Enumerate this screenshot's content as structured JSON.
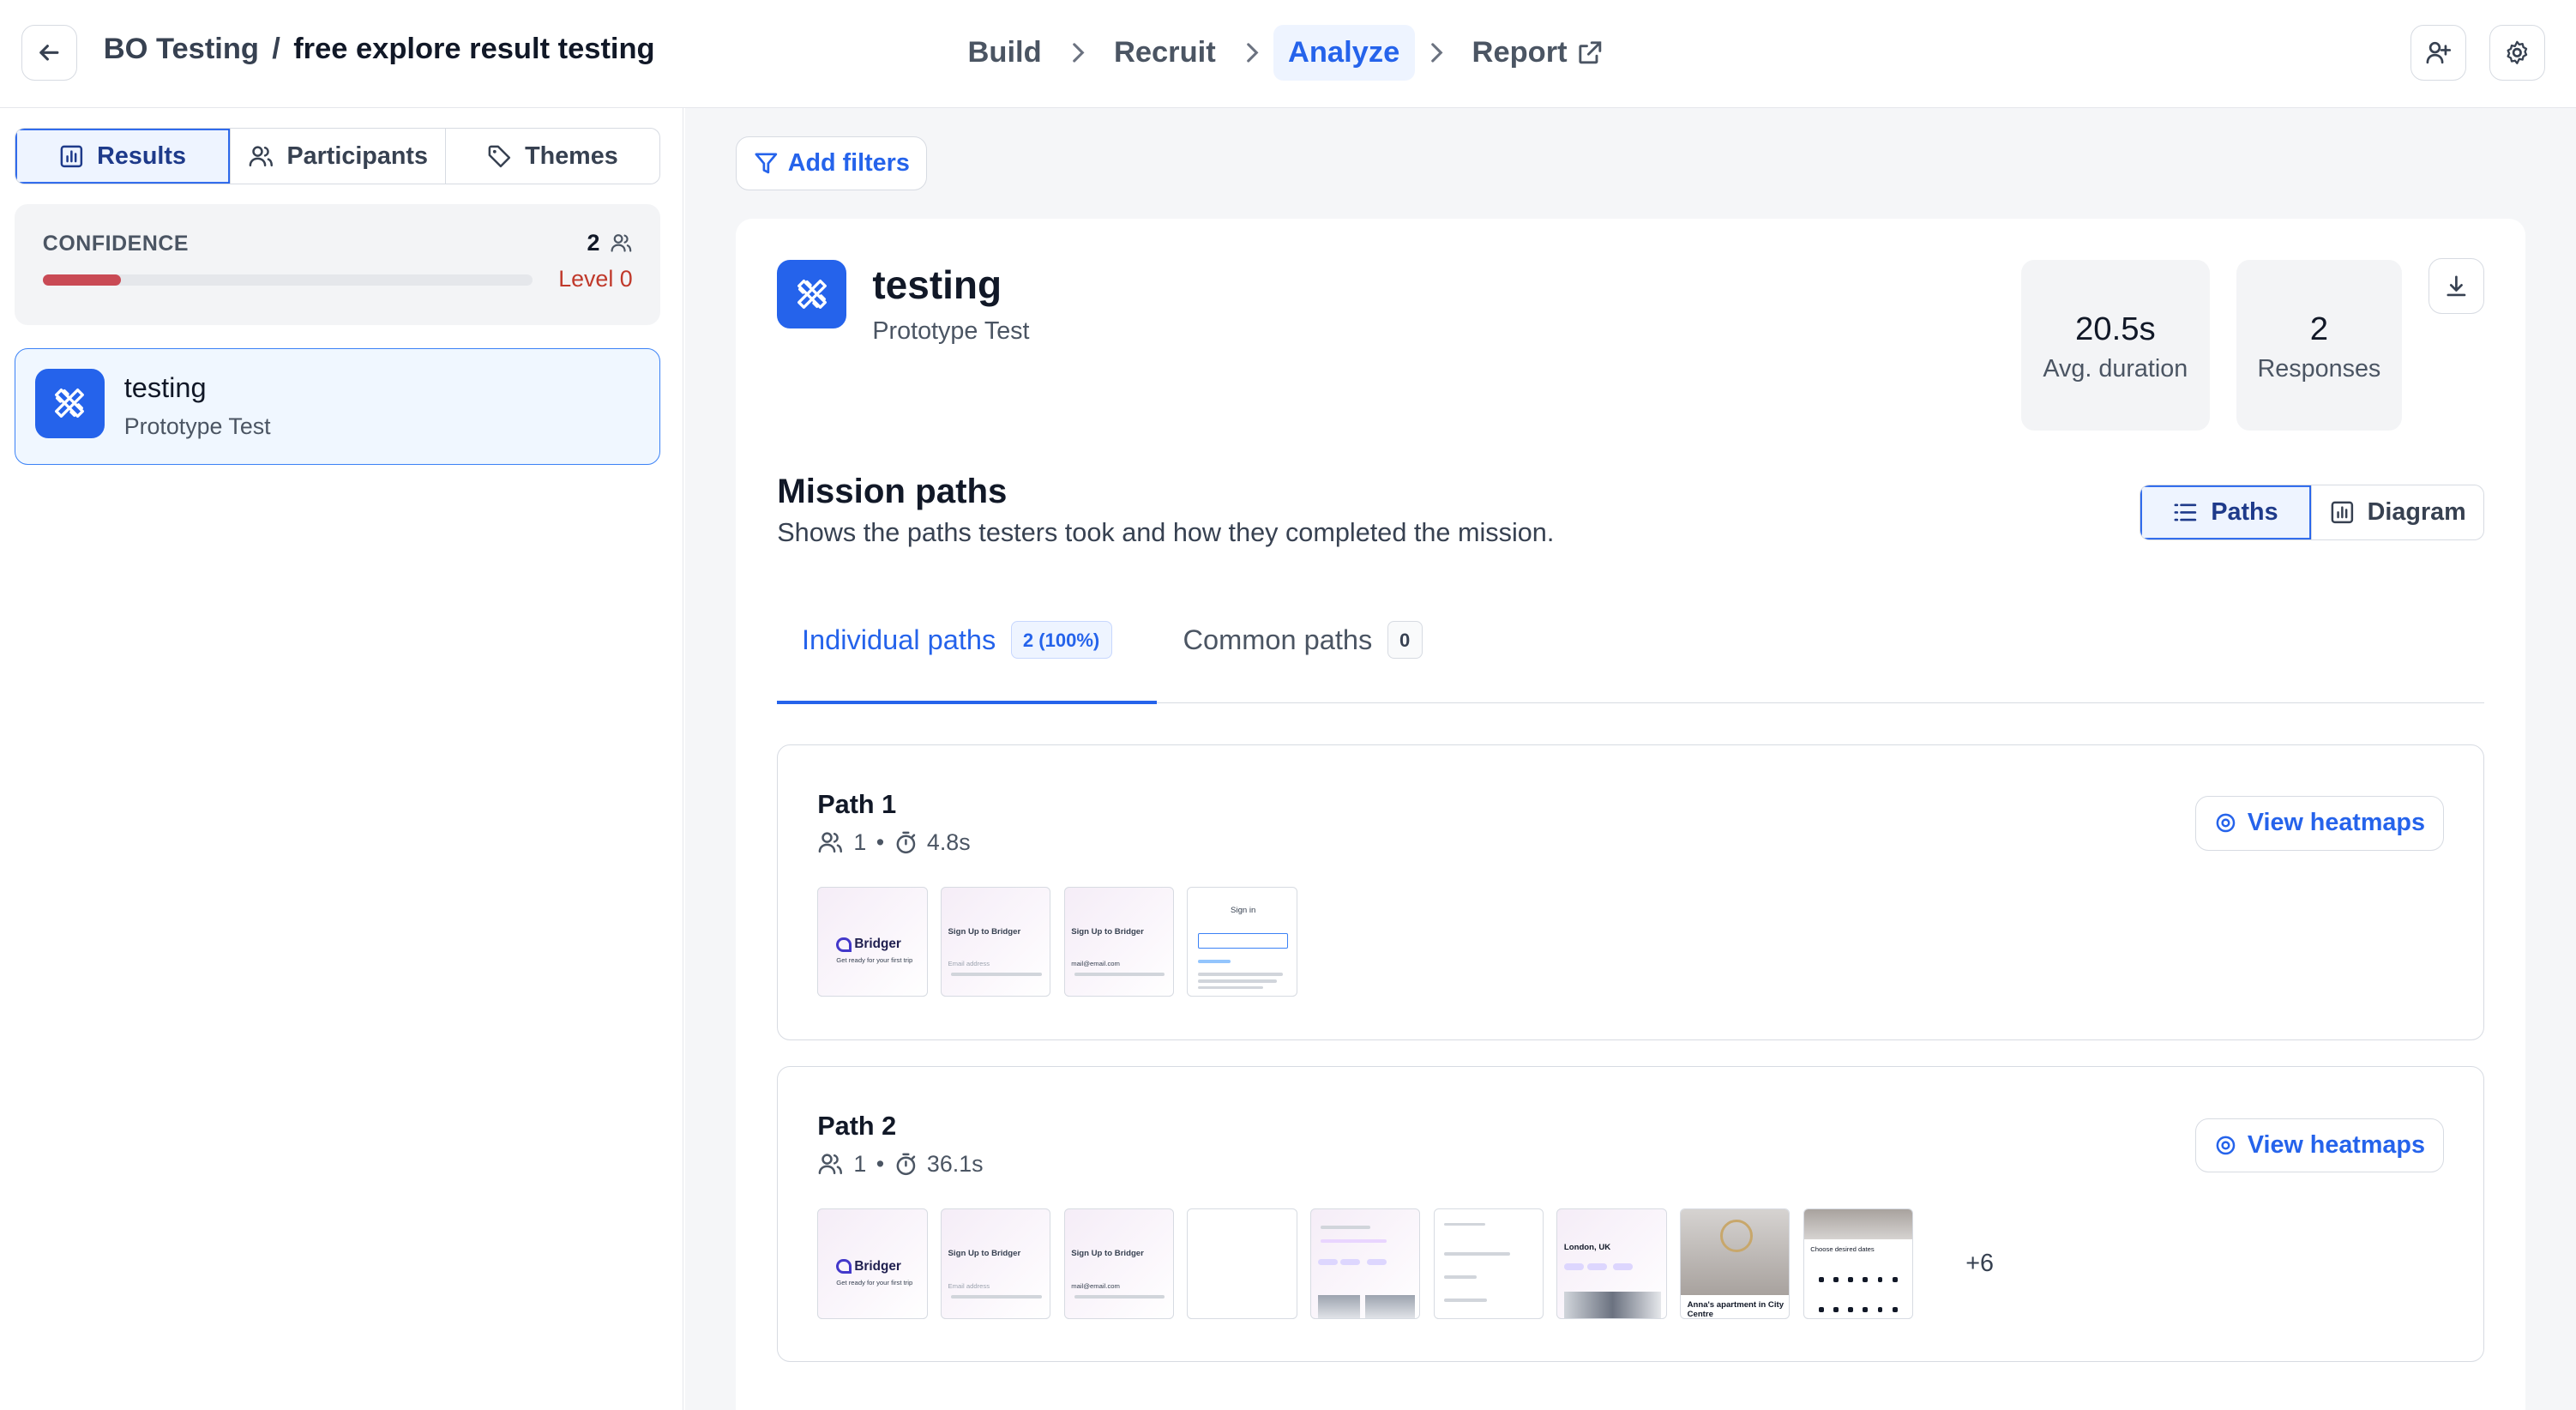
{
  "topbar": {
    "project": "BO Testing",
    "separator": "/",
    "study": "free explore result testing",
    "steps": [
      {
        "label": "Build"
      },
      {
        "label": "Recruit"
      },
      {
        "label": "Analyze",
        "active": true
      },
      {
        "label": "Report"
      }
    ]
  },
  "sidebar": {
    "tabs": [
      "Results",
      "Participants",
      "Themes"
    ],
    "confidence": {
      "label": "CONFIDENCE",
      "count": "2",
      "level": "Level 0",
      "progress": 0.16
    },
    "task": {
      "title": "testing",
      "type": "Prototype Test"
    }
  },
  "main": {
    "filters_label": "Add filters",
    "header": {
      "title": "testing",
      "type": "Prototype Test"
    },
    "stats": [
      {
        "value": "20.5s",
        "label": "Avg. duration"
      },
      {
        "value": "2",
        "label": "Responses"
      }
    ],
    "section": {
      "title": "Mission paths",
      "subtitle": "Shows the paths testers took and how they completed the mission."
    },
    "view_toggle": [
      "Paths",
      "Diagram"
    ],
    "tabs": [
      {
        "label": "Individual paths",
        "badge": "2 (100%)"
      },
      {
        "label": "Common paths",
        "badge": "0"
      }
    ],
    "paths": [
      {
        "title": "Path 1",
        "users": "1",
        "duration": "4.8s",
        "heatmap_label": "View heatmaps",
        "more": ""
      },
      {
        "title": "Path 2",
        "users": "1",
        "duration": "36.1s",
        "heatmap_label": "View heatmaps",
        "more": "+6"
      }
    ],
    "thumb_text": {
      "brand": "Bridger",
      "tagline": "Get ready for your first trip",
      "signup": "Sign Up to",
      "email": "Email address",
      "email_value": "mail@email.com",
      "signin": "Sign in",
      "city": "London, UK",
      "apartment": "Anna's apartment in City Centre",
      "dates": "Choose desired dates"
    }
  },
  "colors": {
    "accent": "#2563eb",
    "accent_bg": "#eef4ff",
    "confidence_fill": "#c94a55",
    "level_text": "#c0392b"
  }
}
